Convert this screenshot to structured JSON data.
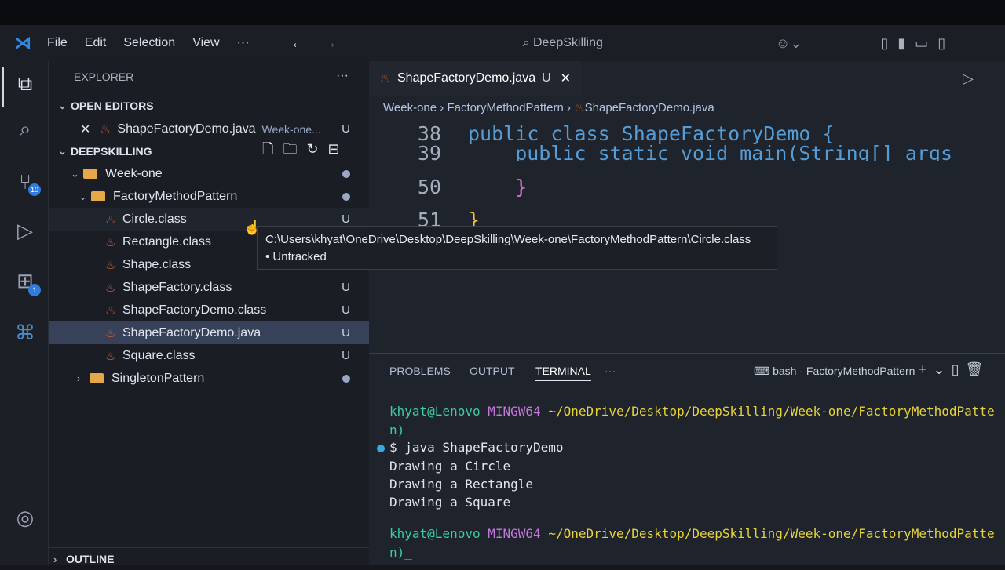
{
  "titlebar": {
    "menus": [
      "File",
      "Edit",
      "Selection",
      "View",
      "···"
    ],
    "search": "DeepSkilling"
  },
  "activity": {
    "scm_badge": "10",
    "ext_badge": "1"
  },
  "sidebar": {
    "title": "EXPLORER",
    "more": "···",
    "open_editors": "OPEN EDITORS",
    "open_file": "ShapeFactoryDemo.java",
    "open_file_path": "Week-one...",
    "open_file_status": "U",
    "workspace": "DEEPSKILLING",
    "tree": [
      {
        "label": "Week-one",
        "kind": "folder",
        "status": "dot"
      },
      {
        "label": "FactoryMethodPattern",
        "kind": "folder",
        "status": "dot"
      },
      {
        "label": "Circle.class",
        "kind": "file",
        "status": "U"
      },
      {
        "label": "Rectangle.class",
        "kind": "file",
        "status": ""
      },
      {
        "label": "Shape.class",
        "kind": "file",
        "status": ""
      },
      {
        "label": "ShapeFactory.class",
        "kind": "file",
        "status": "U"
      },
      {
        "label": "ShapeFactoryDemo.class",
        "kind": "file",
        "status": "U"
      },
      {
        "label": "ShapeFactoryDemo.java",
        "kind": "file",
        "status": "U"
      },
      {
        "label": "Square.class",
        "kind": "file",
        "status": "U"
      },
      {
        "label": "SingletonPattern",
        "kind": "folder",
        "status": "dot"
      }
    ],
    "outline": "OUTLINE"
  },
  "editor": {
    "tab": "ShapeFactoryDemo.java",
    "tab_status": "U",
    "breadcrumb": [
      "Week-one",
      "FactoryMethodPattern",
      "ShapeFactoryDemo.java"
    ],
    "lines": [
      {
        "n": "38",
        "code": "public class ShapeFactoryDemo {"
      },
      {
        "n": "39",
        "code": "    public static void main(String[] args"
      },
      {
        "n": "50",
        "code": "    }"
      },
      {
        "n": "51",
        "code": "}"
      }
    ]
  },
  "tooltip": {
    "path": "C:\\Users\\khyat\\OneDrive\\Desktop\\DeepSkilling\\Week-one\\FactoryMethodPattern\\Circle.class",
    "status": "• Untracked"
  },
  "panel": {
    "tabs": [
      "PROBLEMS",
      "OUTPUT",
      "TERMINAL",
      "···"
    ],
    "active": "TERMINAL",
    "shell": "bash - FactoryMethodPattern",
    "terminal": {
      "user": "khyat@Lenovo",
      "host": "MINGW64",
      "path": "~/OneDrive/Desktop/DeepSkilling/Week-one/FactoryMethodPatte",
      "wrap": "n)",
      "command": "$ java ShapeFactoryDemo",
      "output": [
        "Drawing a Circle",
        "Drawing a Rectangle",
        "Drawing a Square"
      ],
      "wrap2": "n)_"
    }
  }
}
